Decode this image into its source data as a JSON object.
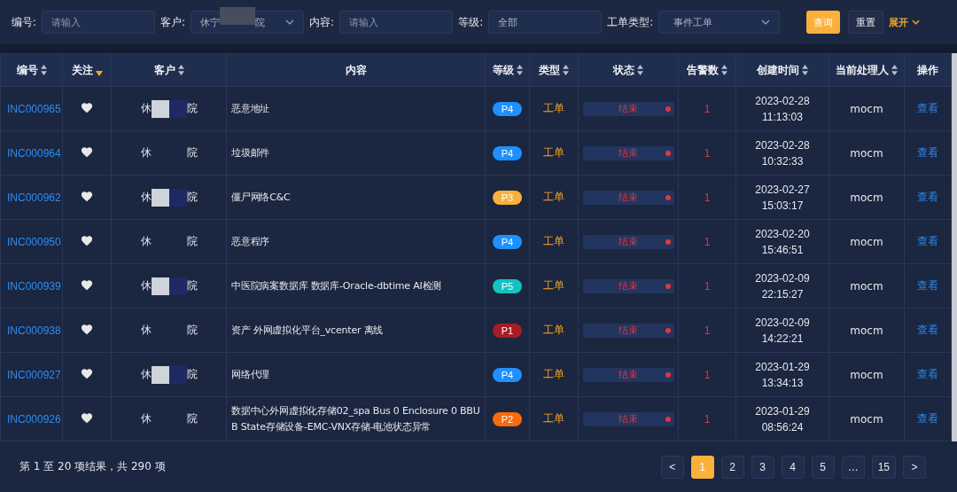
{
  "filters": [
    {
      "label": "编号:",
      "kind": "input",
      "placeholder": "请输入"
    },
    {
      "label": "客户:",
      "kind": "select",
      "value": "休宁",
      "value_tail": "院",
      "masked": true
    },
    {
      "label": "内容:",
      "kind": "input",
      "placeholder": "请输入"
    },
    {
      "label": "等级:",
      "kind": "input",
      "value": "全部"
    },
    {
      "label": "工单类型:",
      "kind": "select",
      "value": "事件工单"
    }
  ],
  "actions": {
    "query": "查询",
    "reset": "重置",
    "expand": "展开"
  },
  "table": {
    "columns": [
      {
        "label": "编号",
        "sortable": true,
        "sorted": false
      },
      {
        "label": "关注",
        "sortable": true,
        "sorted": true
      },
      {
        "label": "客户",
        "sortable": true,
        "sorted": false
      },
      {
        "label": "内容",
        "sortable": false,
        "sorted": false
      },
      {
        "label": "等级",
        "sortable": true,
        "sorted": false
      },
      {
        "label": "类型",
        "sortable": true,
        "sorted": false
      },
      {
        "label": "状态",
        "sortable": true,
        "sorted": false
      },
      {
        "label": "告警数",
        "sortable": true,
        "sorted": false
      },
      {
        "label": "创建时间",
        "sortable": true,
        "sorted": false
      },
      {
        "label": "当前处理人",
        "sortable": true,
        "sorted": false
      },
      {
        "label": "操作",
        "sortable": false,
        "sorted": false
      }
    ],
    "rows": [
      {
        "id": "INC000965",
        "customer_head": "休",
        "customer_tail": "院",
        "masked": true,
        "content": "恶意地址",
        "level": "P4",
        "color": "#1e90ff",
        "type": "工单",
        "status": "结束",
        "alerts": "1",
        "date": "2023-02-28",
        "time": "11:13:03",
        "handler": "mocm",
        "action": "查看"
      },
      {
        "id": "INC000964",
        "customer_head": "休",
        "customer_tail": "院",
        "masked": false,
        "content": "垃圾邮件",
        "level": "P4",
        "color": "#1e90ff",
        "type": "工单",
        "status": "结束",
        "alerts": "1",
        "date": "2023-02-28",
        "time": "10:32:33",
        "handler": "mocm",
        "action": "查看"
      },
      {
        "id": "INC000962",
        "customer_head": "休",
        "customer_tail": "院",
        "masked": true,
        "content": "僵尸网络C&C",
        "level": "P3",
        "color": "#fbb03b",
        "type": "工单",
        "status": "结束",
        "alerts": "1",
        "date": "2023-02-27",
        "time": "15:03:17",
        "handler": "mocm",
        "action": "查看"
      },
      {
        "id": "INC000950",
        "customer_head": "休",
        "customer_tail": "院",
        "masked": false,
        "content": "恶意程序",
        "level": "P4",
        "color": "#1e90ff",
        "type": "工单",
        "status": "结束",
        "alerts": "1",
        "date": "2023-02-20",
        "time": "15:46:51",
        "handler": "mocm",
        "action": "查看"
      },
      {
        "id": "INC000939",
        "customer_head": "休",
        "customer_tail": "院",
        "masked": true,
        "content": "中医院病案数据库 数据库-Oracle-dbtime AI检测",
        "level": "P5",
        "color": "#13c2c2",
        "type": "工单",
        "status": "结束",
        "alerts": "1",
        "date": "2023-02-09",
        "time": "22:15:27",
        "handler": "mocm",
        "action": "查看"
      },
      {
        "id": "INC000938",
        "customer_head": "休",
        "customer_tail": "院",
        "masked": false,
        "content": "资产 外网虚拟化平台_vcenter 离线",
        "level": "P1",
        "color": "#a61d24",
        "type": "工单",
        "status": "结束",
        "alerts": "1",
        "date": "2023-02-09",
        "time": "14:22:21",
        "handler": "mocm",
        "action": "查看"
      },
      {
        "id": "INC000927",
        "customer_head": "休",
        "customer_tail": "院",
        "masked": true,
        "content": "网络代理",
        "level": "P4",
        "color": "#1e90ff",
        "type": "工单",
        "status": "结束",
        "alerts": "1",
        "date": "2023-01-29",
        "time": "13:34:13",
        "handler": "mocm",
        "action": "查看"
      },
      {
        "id": "INC000926",
        "customer_head": "休",
        "customer_tail": "院",
        "masked": false,
        "content": "数据中心外网虚拟化存储02_spa Bus 0 Enclosure 0 BBU B State存储设备-EMC-VNX存储-电池状态异常",
        "level": "P2",
        "color": "#fa6a0a",
        "type": "工单",
        "status": "结束",
        "alerts": "1",
        "date": "2023-01-29",
        "time": "08:56:24",
        "handler": "mocm",
        "action": "查看"
      }
    ]
  },
  "footer": {
    "summary": "第 1 至 20 项结果，共 290 项",
    "prev": "<",
    "next": ">",
    "pages": [
      {
        "label": "1",
        "selected": true
      },
      {
        "label": "2",
        "selected": false
      },
      {
        "label": "3",
        "selected": false
      },
      {
        "label": "4",
        "selected": false
      },
      {
        "label": "5",
        "selected": false
      },
      {
        "label": "…",
        "selected": false
      },
      {
        "label": "15",
        "selected": false
      }
    ]
  }
}
